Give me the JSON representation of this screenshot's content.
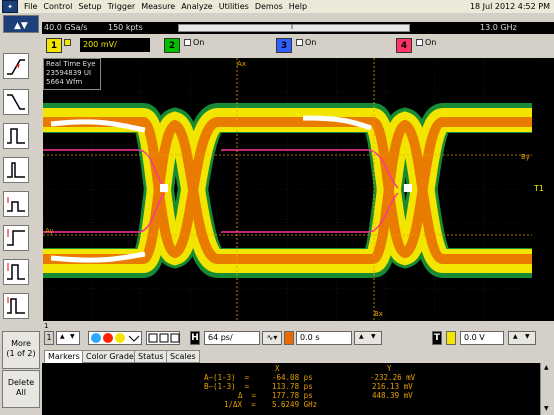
{
  "menu": {
    "items": [
      "File",
      "Control",
      "Setup",
      "Trigger",
      "Measure",
      "Analyze",
      "Utilities",
      "Demos",
      "Help"
    ],
    "datetime": "18 Jul 2012  4:52 PM"
  },
  "status": {
    "sample_rate": "40.0 GSa/s",
    "points": "150 kpts",
    "bandwidth": "13.0 GHz",
    "bw_marker": "i"
  },
  "channels": [
    {
      "num": "1",
      "color": "#f2e600",
      "scale": "200 mV/",
      "checked": true
    },
    {
      "num": "2",
      "color": "#00c000",
      "label": "On",
      "checked": false
    },
    {
      "num": "3",
      "color": "#3060ff",
      "label": "On",
      "checked": false
    },
    {
      "num": "4",
      "color": "#ff3366",
      "label": "On",
      "checked": false
    }
  ],
  "eye_info": {
    "line1": "Real Time Eye",
    "line2": "23594839 UI",
    "line3": "5664 Wfm"
  },
  "marker_labels": {
    "ax": "Ax",
    "ay": "Ay",
    "bx": "Bx",
    "by": "By",
    "t1": "T1",
    "m1": "1"
  },
  "controls": {
    "ch_sel": "1",
    "time_scale": "64 ps/",
    "time_delay": "0.0 s",
    "trig_level": "0.0 V",
    "trig_label": "T"
  },
  "tabs": [
    "Markers",
    "Color Grade",
    "Status",
    "Scales"
  ],
  "active_tab": "Markers",
  "markers_table": {
    "header_x": "X",
    "header_y": "Y",
    "rows": [
      {
        "label": "A—(1-3)  =",
        "x": "-64.08 ps",
        "y": "-232.26 mV"
      },
      {
        "label": "B—(1-3)  =",
        "x": "113.78 ps",
        "y": "216.13 mV"
      },
      {
        "label": "Δ  =",
        "x": "177.78 ps",
        "y": "448.39 mV"
      },
      {
        "label": "1/ΔX  =",
        "x": "5.6249 GHz",
        "y": ""
      }
    ]
  },
  "side_buttons": {
    "more": "More",
    "page": "(1 of 2)",
    "delete": "Delete",
    "all": "All"
  },
  "toolbar_icons": [
    "rising-edge-icon",
    "falling-edge-icon",
    "pulse-width-icon",
    "glitch-icon",
    "runt-icon",
    "setup-hold-icon",
    "transition-icon",
    "timeout-icon",
    "pattern-icon"
  ]
}
